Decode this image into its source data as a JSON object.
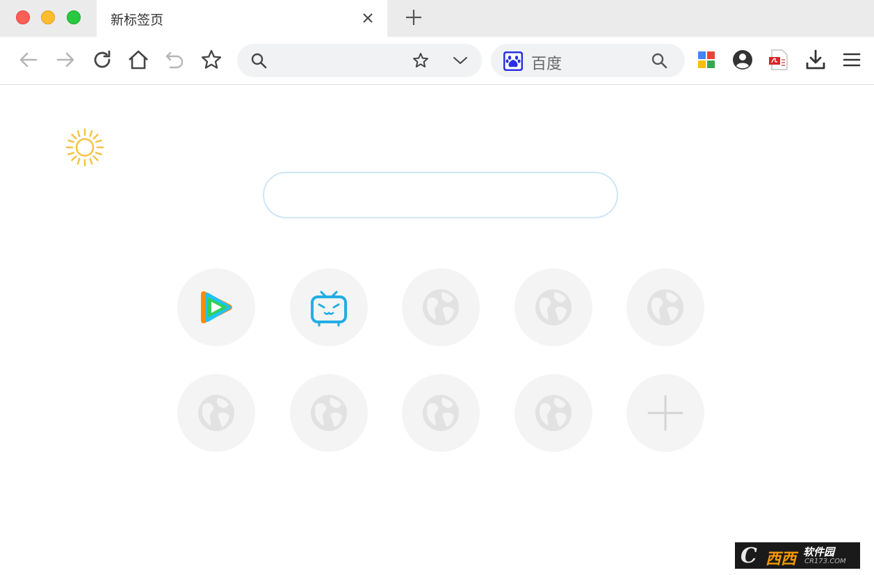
{
  "window": {
    "traffic_lights": {
      "close": "#fe5f57",
      "minimize": "#febc2e",
      "maximize": "#28c840"
    }
  },
  "tabs": [
    {
      "title": "新标签页",
      "active": true
    }
  ],
  "toolbar": {
    "buttons": [
      "back-icon",
      "forward-icon",
      "reload-icon",
      "home-icon",
      "undo-icon",
      "bookmark-star-icon"
    ],
    "address_bar": {
      "value": "",
      "placeholder": ""
    },
    "search_engine": {
      "name": "百度",
      "logo_color": "#2932e1"
    },
    "extensions": [
      "apps-grid-icon",
      "account-icon",
      "pdf-icon",
      "download-icon",
      "menu-icon"
    ]
  },
  "page": {
    "weather_icon": "sun-icon",
    "weather_color": "#f5c242",
    "search_box": {
      "value": "",
      "placeholder": ""
    },
    "speed_dial": {
      "rows": [
        [
          "tencent-video-icon",
          "bilibili-tv-icon",
          "globe-icon",
          "globe-icon",
          "globe-icon"
        ],
        [
          "globe-icon",
          "globe-icon",
          "globe-icon",
          "globe-icon",
          "add-icon"
        ]
      ]
    }
  },
  "watermark": {
    "brand": "西西软件园",
    "letter": "C",
    "xixi": "西西",
    "name": "软件园",
    "url": "CR173.COM"
  }
}
